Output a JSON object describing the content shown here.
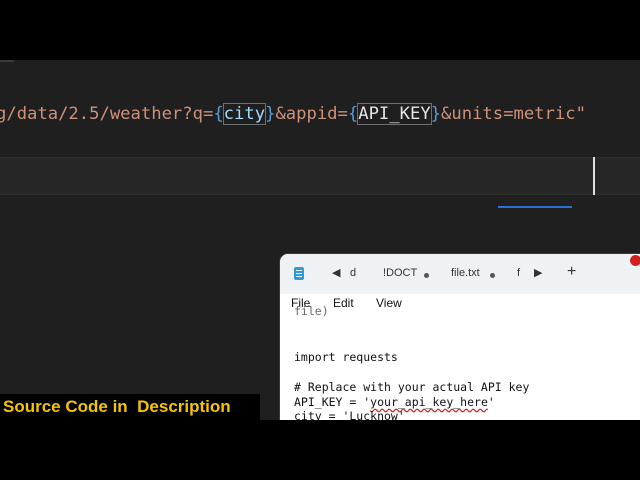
{
  "editor": {
    "code_parts": {
      "p1": "g/data/2.5/weather?q=",
      "b1": "{",
      "v1": "city",
      "b2": "}",
      "p2": "&appid=",
      "b3": "{",
      "v2": "API_KEY",
      "b4": "}",
      "p3": "&units=metric",
      "q": "\""
    }
  },
  "notepad": {
    "tabs": {
      "back_icon": "left-arrow-icon",
      "partial_left": "d",
      "tab1": "!DOCT",
      "tab2": "file.txt",
      "partial_right": "f",
      "plus": "+"
    },
    "menu": {
      "file": "File",
      "edit": "Edit",
      "view": "View"
    },
    "lines": {
      "l0": "file)",
      "l1": "import requests",
      "l2": "# Replace with your actual API key",
      "l3_a": "API_KEY = '",
      "l3_b": "your_api_key_here",
      "l3_c": "'",
      "l4": "city = 'Lucknow'"
    }
  },
  "caption": {
    "text": "Source Code in  Description"
  },
  "colors": {
    "caption": "#f5c400",
    "string": "#ce9178",
    "variable": "#9cdcfe",
    "editor_bg": "#1f1f1f"
  }
}
